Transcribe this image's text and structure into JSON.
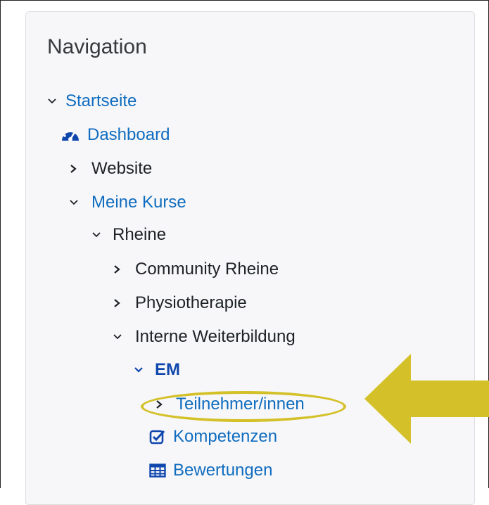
{
  "block": {
    "title": "Navigation"
  },
  "nav": {
    "startseite": "Startseite",
    "dashboard": "Dashboard",
    "website": "Website",
    "meine_kurse": "Meine Kurse",
    "rheine": "Rheine",
    "community_rheine": "Community Rheine",
    "physiotherapie": "Physiotherapie",
    "interne_weiterbildung": "Interne Weiterbildung",
    "em": "EM",
    "teilnehmer": "Teilnehmer/innen",
    "kompetenzen": "Kompetenzen",
    "bewertungen": "Bewertungen"
  },
  "icons": {
    "dashboard": "tachometer-icon",
    "kompetenzen": "checkbox-icon",
    "bewertungen": "table-icon"
  },
  "colors": {
    "link": "#0f6cbf",
    "text": "#1d2125",
    "highlight": "#d4c129"
  }
}
